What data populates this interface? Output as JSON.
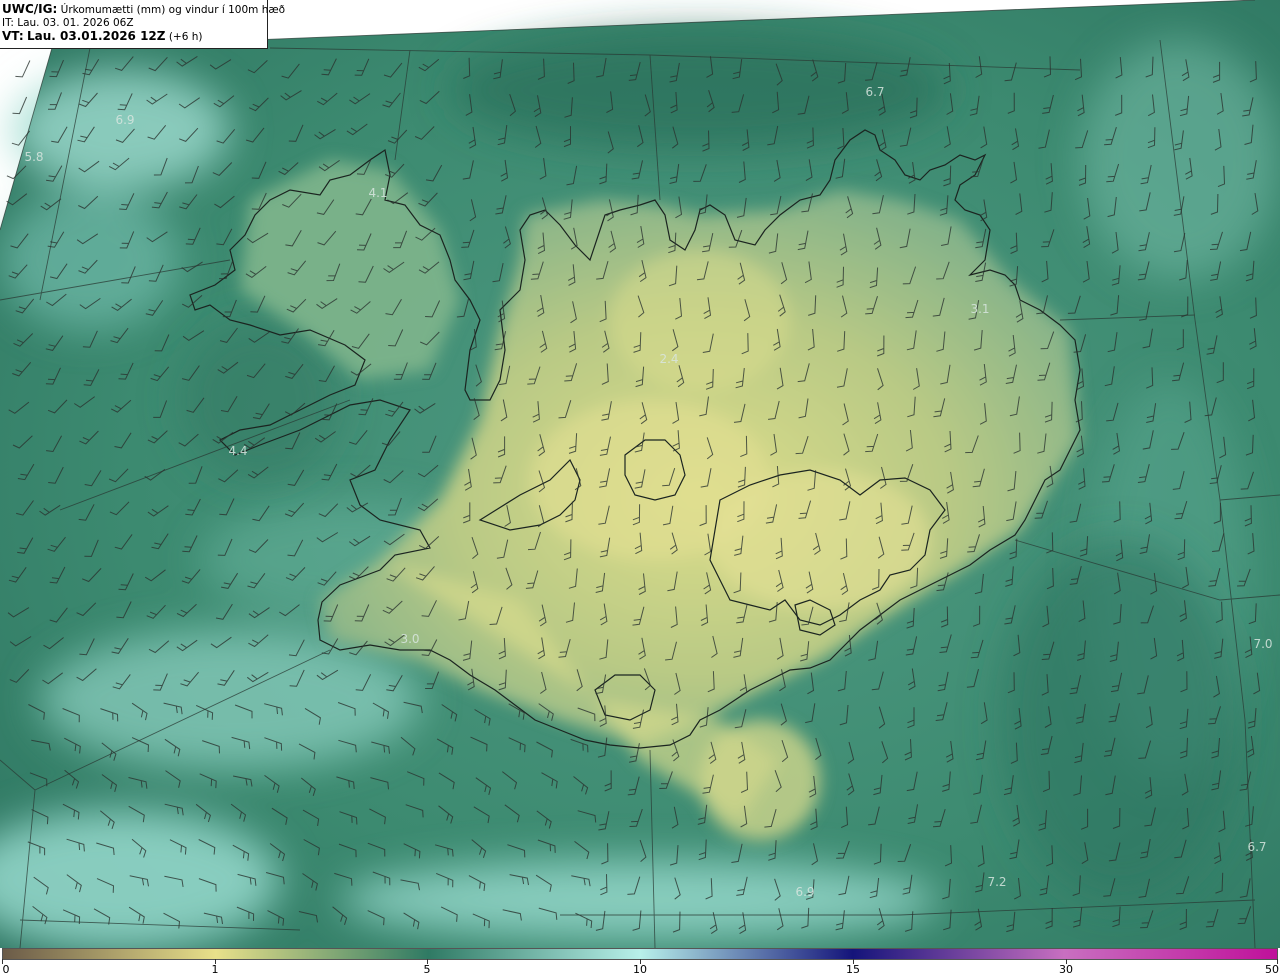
{
  "header": {
    "model_label": "UWC/IG:",
    "title": "Úrkomumætti (mm) og vindur í 100m hæð",
    "init_time": "IT: Lau. 03. 01. 2026 06Z",
    "valid_label": "VT:",
    "valid_time": "Lau. 03.01.2026 12Z",
    "lead_time": "(+6 h)"
  },
  "colors": {
    "sea_dark": "#2f7a64",
    "sea_light": "#8fd6c8",
    "land_low": "#d9dc8a",
    "land_mid": "#a9c283",
    "coast": "#1b2420",
    "wind_barb": "#2b3330"
  },
  "map_labels": [
    {
      "text": "5.8"
    },
    {
      "text": "6.9"
    },
    {
      "text": "4.1"
    },
    {
      "text": "6.7"
    },
    {
      "text": "3.1"
    },
    {
      "text": "2.4"
    },
    {
      "text": "4.4"
    },
    {
      "text": "3.0"
    },
    {
      "text": "7.0"
    },
    {
      "text": "6.7"
    },
    {
      "text": "7.2"
    },
    {
      "text": "6.9"
    }
  ],
  "colorbar": {
    "ticks": [
      "0",
      "1",
      "5",
      "10",
      "15",
      "30",
      "50"
    ],
    "stops": [
      "#6b5b48",
      "#e8e08a",
      "#2f7a64",
      "#b8f0ea",
      "#14147a",
      "#c86fc0",
      "#c0109a"
    ]
  }
}
